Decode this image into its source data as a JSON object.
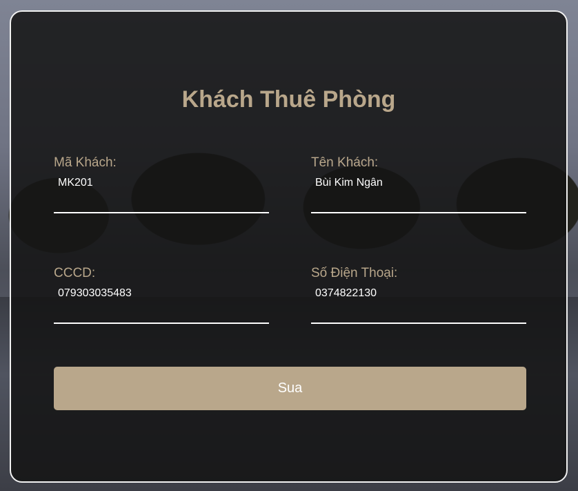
{
  "form": {
    "title": "Khách Thuê Phòng",
    "fields": [
      {
        "label": "Mã Khách:",
        "value": "MK201"
      },
      {
        "label": "Tên Khách:",
        "value": "Bùi Kim Ngân"
      },
      {
        "label": "CCCD:",
        "value": "079303035483"
      },
      {
        "label": "Số Điện Thoại:",
        "value": "0374822130"
      }
    ],
    "submit_label": "Sua"
  },
  "colors": {
    "accent": "#b9a78b",
    "card_background": "#141414",
    "text": "#ffffff"
  }
}
